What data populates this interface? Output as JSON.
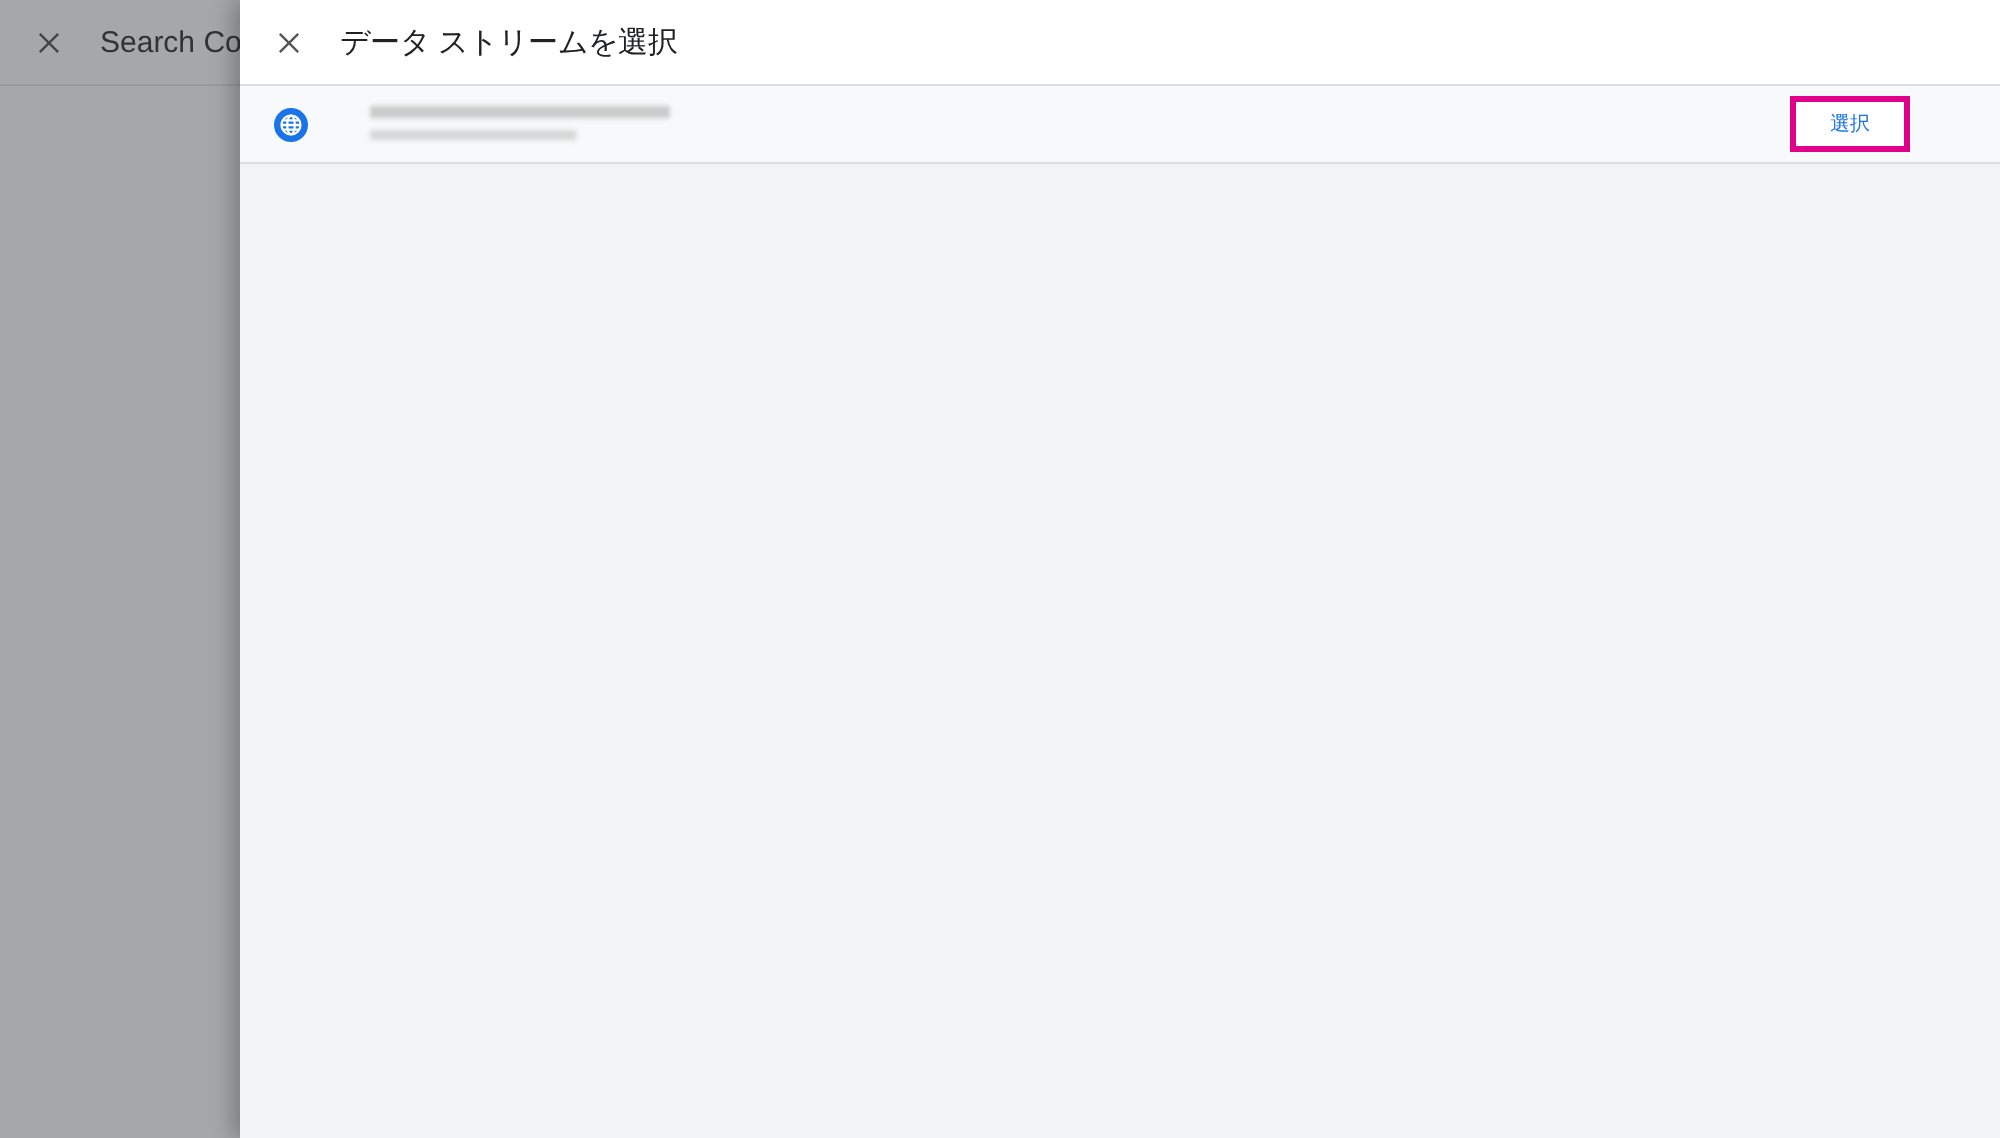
{
  "background_page": {
    "title": "Search Co"
  },
  "panel": {
    "title": "データ ストリームを選択",
    "streams": [
      {
        "kind": "web",
        "action": "選択",
        "highlighted": true
      }
    ]
  }
}
